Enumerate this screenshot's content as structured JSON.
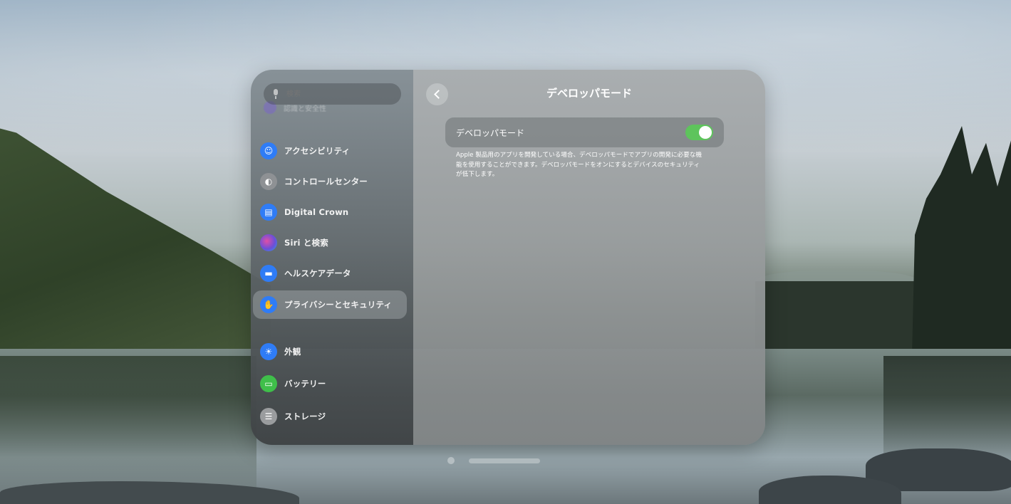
{
  "sidebar": {
    "search_placeholder": "検索",
    "faded_item": "認識と安全性",
    "items": [
      {
        "label": "アクセシビリティ",
        "icon": "accessibility-icon",
        "color": "#2f7cf6"
      },
      {
        "label": "コントロールセンター",
        "icon": "control-center-icon",
        "color": "#8e9194"
      },
      {
        "label": "Digital Crown",
        "icon": "digital-crown-icon",
        "color": "#2f7cf6"
      },
      {
        "label": "Siri と検索",
        "icon": "siri-icon",
        "color": "#6b4fd8"
      },
      {
        "label": "ヘルスケアデータ",
        "icon": "health-data-icon",
        "color": "#2f7cf6"
      },
      {
        "label": "プライバシーとセキュリティ",
        "icon": "privacy-hand-icon",
        "color": "#2f7cf6",
        "selected": true
      },
      {
        "label": "外観",
        "icon": "appearance-icon",
        "color": "#2f7cf6"
      },
      {
        "label": "バッテリー",
        "icon": "battery-icon",
        "color": "#3fbf4a"
      },
      {
        "label": "ストレージ",
        "icon": "storage-icon",
        "color": "#9a9c9e"
      }
    ]
  },
  "content": {
    "title": "デベロッパモード",
    "row_label": "デベロッパモード",
    "toggle_on": true,
    "description_lines": [
      "Apple 製品用のアプリを開発している場合、デベロッパモードでアプリの開発に必要な機",
      "能を使用することができます。デベロッパモードをオンにするとデバイスのセキュリティ",
      "が低下します。"
    ]
  },
  "colors": {
    "toggle_on": "#5ec45c"
  }
}
